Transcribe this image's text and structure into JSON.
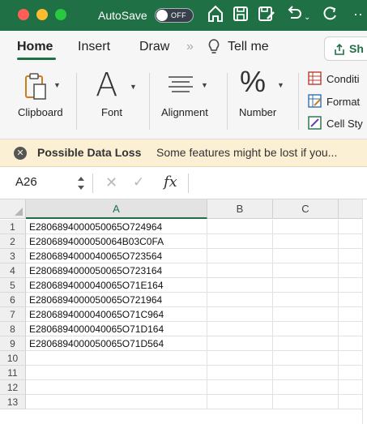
{
  "titlebar": {
    "autosave_label": "AutoSave",
    "autosave_state": "OFF",
    "icons": [
      "home-icon",
      "save-icon",
      "save-as-icon",
      "undo-icon",
      "redo-icon",
      "more-icon"
    ],
    "colors": {
      "brand_green": "#1f7145",
      "close": "#ff5f57",
      "minimize": "#febc2e",
      "zoom": "#28c840"
    }
  },
  "tabs": {
    "home": "Home",
    "insert": "Insert",
    "draw": "Draw",
    "overflow": "»",
    "tell_me": "Tell me",
    "share": "Sh"
  },
  "ribbon": {
    "clipboard": "Clipboard",
    "font": "Font",
    "alignment": "Alignment",
    "number": "Number",
    "conditional": "Conditi",
    "format": "Format",
    "cell_styles": "Cell Sty"
  },
  "message_bar": {
    "title": "Possible Data Loss",
    "text": "Some features might be lost if you..."
  },
  "formula_bar": {
    "name_box": "A26",
    "fx": "fx"
  },
  "sheet": {
    "columns": [
      "A",
      "B",
      "C"
    ],
    "selected_column": "A",
    "rows": [
      {
        "num": "1",
        "a": "E2806894000050065O724964"
      },
      {
        "num": "2",
        "a": "E2806894000050064B03C0FA"
      },
      {
        "num": "3",
        "a": "E2806894000040065O723564"
      },
      {
        "num": "4",
        "a": "E2806894000050065O723164"
      },
      {
        "num": "5",
        "a": "E2806894000040065O71E164"
      },
      {
        "num": "6",
        "a": "E2806894000050065O721964"
      },
      {
        "num": "7",
        "a": "E2806894000040065O71C964"
      },
      {
        "num": "8",
        "a": "E2806894000040065O71D164"
      },
      {
        "num": "9",
        "a": "E2806894000050065O71D564"
      },
      {
        "num": "10",
        "a": ""
      },
      {
        "num": "11",
        "a": ""
      },
      {
        "num": "12",
        "a": ""
      },
      {
        "num": "13",
        "a": ""
      }
    ]
  }
}
